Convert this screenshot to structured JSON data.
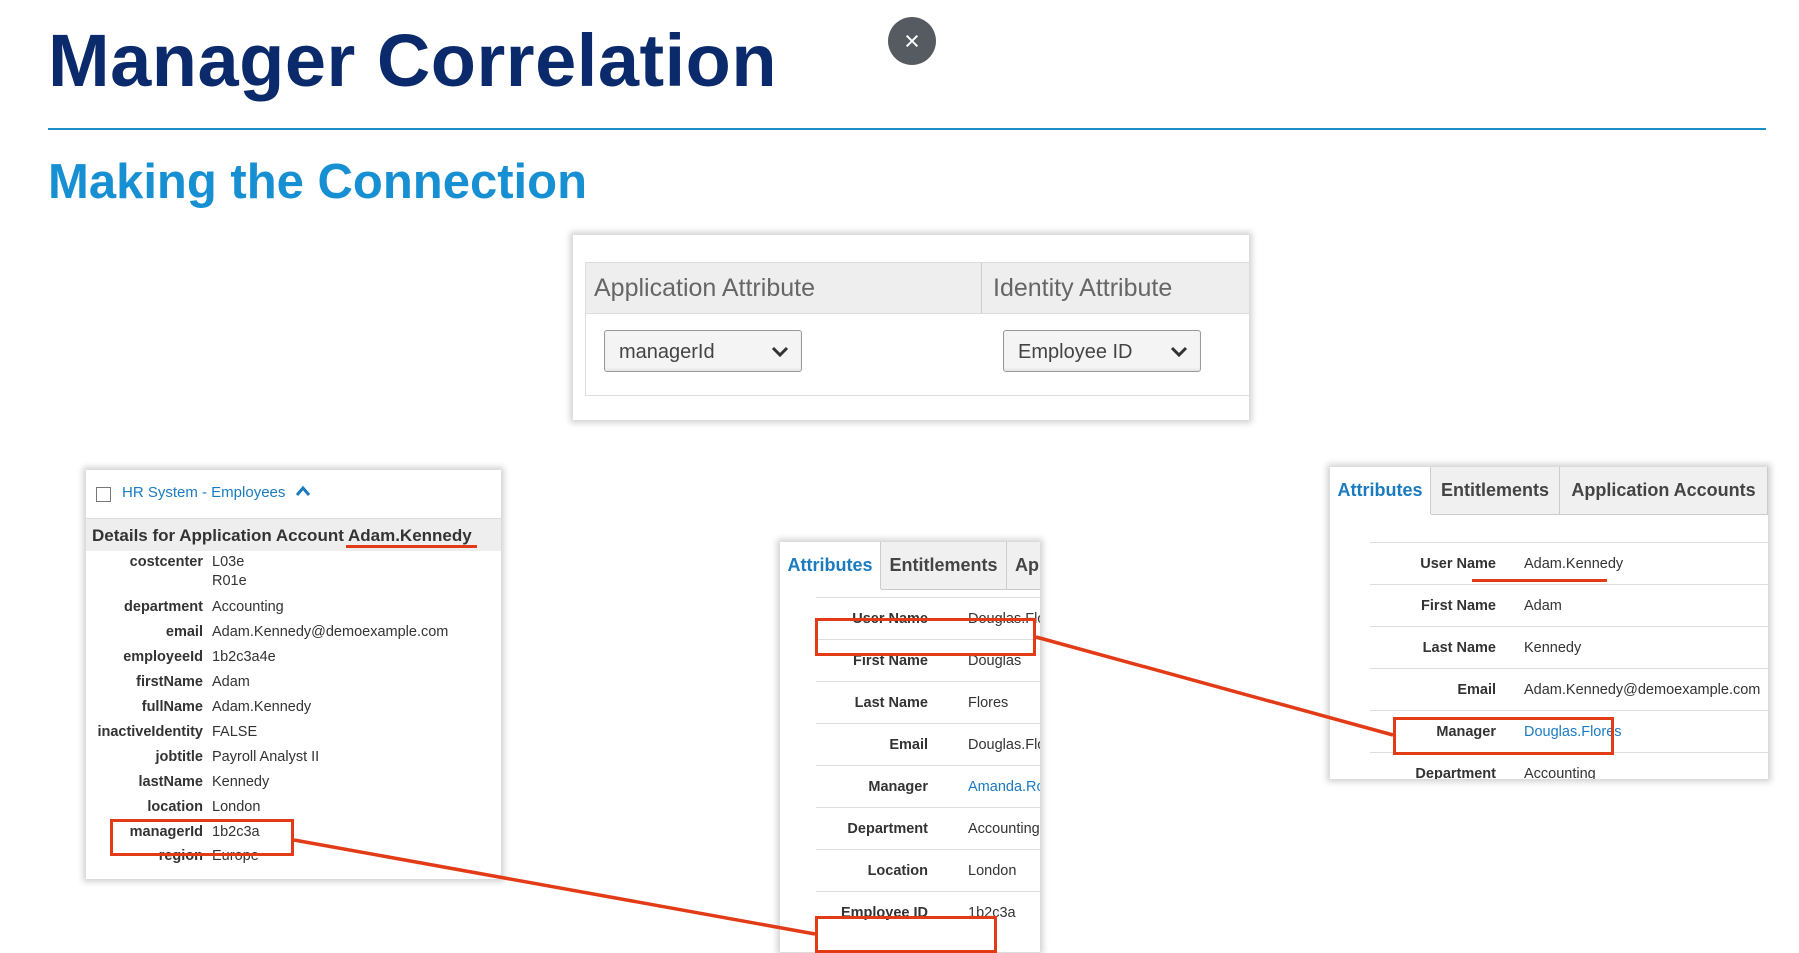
{
  "header": {
    "title": "Manager Correlation",
    "subtitle": "Making the Connection",
    "close_glyph": "×"
  },
  "mapping": {
    "col1": "Application Attribute",
    "col2": "Identity Attribute",
    "app_select": "managerId",
    "identity_select": "Employee ID"
  },
  "hr": {
    "title": "HR System - Employees",
    "details_prefix": "Details for Application Account",
    "account": "Adam.Kennedy",
    "rows": [
      {
        "k": "costcenter",
        "v": "L03e"
      },
      {
        "k": "",
        "v": "R01e"
      },
      {
        "k": "department",
        "v": "Accounting"
      },
      {
        "k": "email",
        "v": "Adam.Kennedy@demoexample.com"
      },
      {
        "k": "employeeId",
        "v": "1b2c3a4e"
      },
      {
        "k": "firstName",
        "v": "Adam"
      },
      {
        "k": "fullName",
        "v": "Adam.Kennedy"
      },
      {
        "k": "inactiveIdentity",
        "v": "FALSE"
      },
      {
        "k": "jobtitle",
        "v": "Payroll Analyst II"
      },
      {
        "k": "lastName",
        "v": "Kennedy"
      },
      {
        "k": "location",
        "v": "London"
      },
      {
        "k": "managerId",
        "v": "1b2c3a"
      },
      {
        "k": "region",
        "v": "Europe"
      }
    ]
  },
  "manager_identity": {
    "tabs": [
      "Attributes",
      "Entitlements",
      "Ap"
    ],
    "rows": [
      {
        "k": "User Name",
        "v": "Douglas.Flores"
      },
      {
        "k": "First Name",
        "v": "Douglas"
      },
      {
        "k": "Last Name",
        "v": "Flores"
      },
      {
        "k": "Email",
        "v": "Douglas.Flores@"
      },
      {
        "k": "Manager",
        "v": "Amanda.Ross"
      },
      {
        "k": "Department",
        "v": "Accounting"
      },
      {
        "k": "Location",
        "v": "London"
      },
      {
        "k": "Employee ID",
        "v": "1b2c3a"
      }
    ]
  },
  "employee_identity": {
    "tabs": [
      "Attributes",
      "Entitlements",
      "Application Accounts"
    ],
    "rows": [
      {
        "k": "User Name",
        "v": "Adam.Kennedy"
      },
      {
        "k": "First Name",
        "v": "Adam"
      },
      {
        "k": "Last Name",
        "v": "Kennedy"
      },
      {
        "k": "Email",
        "v": "Adam.Kennedy@demoexample.com"
      },
      {
        "k": "Manager",
        "v": "Douglas.Flores"
      },
      {
        "k": "Department",
        "v": "Accounting"
      }
    ]
  },
  "colors": {
    "title": "#0b2a6b",
    "accent": "#1690d2",
    "highlight": "#e23b16",
    "link": "#1a7bbf"
  }
}
